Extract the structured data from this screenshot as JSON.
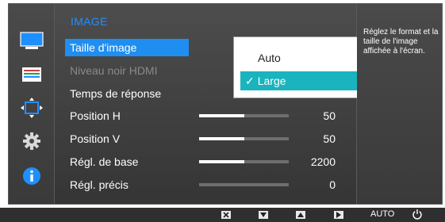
{
  "colors": {
    "accent": "#1f8ef0",
    "selected_option": "#19b4bd",
    "panel": "#3f3f3f"
  },
  "sidebar": {
    "icons": [
      {
        "name": "picture-icon",
        "active": true
      },
      {
        "name": "color-icon",
        "active": false
      },
      {
        "name": "screen-size-icon",
        "active": false
      },
      {
        "name": "settings-gear-icon",
        "active": false
      },
      {
        "name": "information-icon",
        "active": false
      }
    ]
  },
  "menu": {
    "title": "IMAGE",
    "items": [
      {
        "label": "Taille d'image",
        "selected": true
      },
      {
        "label": "Niveau noir HDMI",
        "disabled": true
      },
      {
        "label": "Temps de réponse"
      },
      {
        "label": "Position H",
        "value": "50",
        "level": 0.5
      },
      {
        "label": "Position V",
        "value": "50",
        "level": 0.5
      },
      {
        "label": "Régl. de base",
        "value": "2200",
        "level": 0.5
      },
      {
        "label": "Régl. précis",
        "value": "0",
        "level": 0.0
      }
    ]
  },
  "dropdown": {
    "options": [
      {
        "label": "Auto",
        "active": false
      },
      {
        "label": "Large",
        "active": true
      }
    ],
    "check_glyph": "✓"
  },
  "help": {
    "text": "Réglez le format et la taille de l'image affichée à l'écran."
  },
  "bottom_bar": {
    "buttons": [
      {
        "name": "close-icon",
        "glyph": "✕"
      },
      {
        "name": "down-arrow-icon",
        "glyph": "▼"
      },
      {
        "name": "up-arrow-icon",
        "glyph": "▲"
      },
      {
        "name": "enter-icon",
        "glyph": "▶"
      }
    ],
    "auto_label": "AUTO",
    "power_name": "power-icon"
  }
}
